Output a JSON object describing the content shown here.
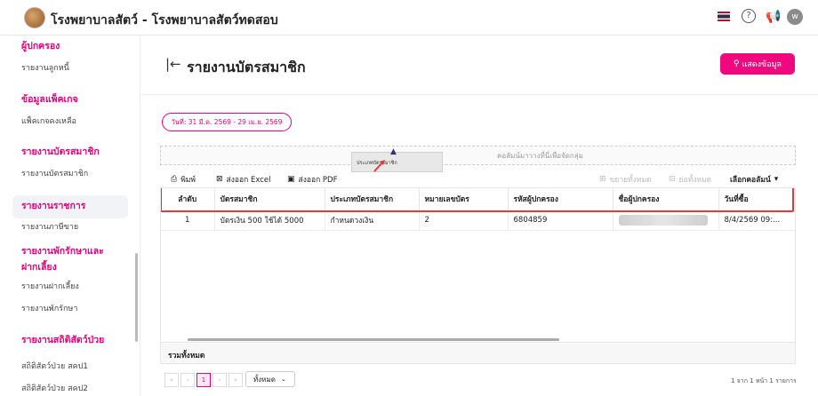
{
  "header": {
    "app_title": "โรงพยาบาลสัตว์ - โรงพยาบาลสัตว์ทดสอบ",
    "avatar_initial": "w",
    "help_symbol": "?"
  },
  "sidebar": {
    "sections": [
      {
        "title": "ผู้ปกครอง",
        "items": [
          "รายงานลูกหนี้"
        ]
      },
      {
        "title": "ข้อมูลแพ็คเกจ",
        "items": [
          "แพ็คเกจคงเหลือ"
        ]
      },
      {
        "title": "รายงานบัตรสมาชิก",
        "items": [
          "รายงานบัตรสมาชิก"
        ]
      },
      {
        "title": "รายงานราชการ",
        "items": [
          "รายงานภาษีขาย"
        ]
      },
      {
        "title": "รายงานพักรักษาและ",
        "title2": "ฝากเลี้ยง",
        "items": [
          "รายงานฝากเลี้ยง",
          "รายงานพักรักษา"
        ]
      },
      {
        "title": "รายงานสถิติสัตว์ป่วย",
        "items": [
          "สถิติสัตว์ป่วย สคป1",
          "สถิติสัตว์ป่วย สคป2"
        ]
      }
    ]
  },
  "page": {
    "title": "รายงานบัตรสมาชิก",
    "show_button": "แสดงข้อมูล",
    "date_range": "วันที่: 31 มี.ค. 2569 - 29 เม.ย. 2569"
  },
  "grid": {
    "group_placeholder": "คอลัมน์มาวางที่นี่เพื่อจัดกลุ่ม",
    "drag_tooltip": "ประเภทบัตรสมาชิก",
    "toolbar": {
      "print": "พิมพ์",
      "export_excel": "ส่งออก Excel",
      "export_pdf": "ส่งออก PDF",
      "expand_all": "ขยายทั้งหมด",
      "collapse_all": "ย่อทั้งหมด",
      "choose_columns": "เลือกคอลัมน์"
    },
    "columns": [
      "ลำดับ",
      "บัตรสมาชิก",
      "ประเภทบัตรสมาชิก",
      "หมายเลขบัตร",
      "รหัสผู้ปกครอง",
      "ชื่อผู้ปกครอง",
      "วันที่ซื้อ"
    ],
    "rows": [
      {
        "no": "1",
        "card": "บัตรเงิน 500 ใช้ได้ 5000",
        "type": "กำหนดวงเงิน",
        "card_no": "2",
        "owner_code": "6804859",
        "owner_name": "",
        "date": "8/4/2569 09:..."
      }
    ],
    "summary_label": "รวมทั้งหมด"
  },
  "pager": {
    "first": "«",
    "prev": "‹",
    "current": "1",
    "next": "›",
    "last": "»",
    "page_size": "ทั้งหมด",
    "info": "1 จาก 1 หน้า 1 รายการ"
  }
}
